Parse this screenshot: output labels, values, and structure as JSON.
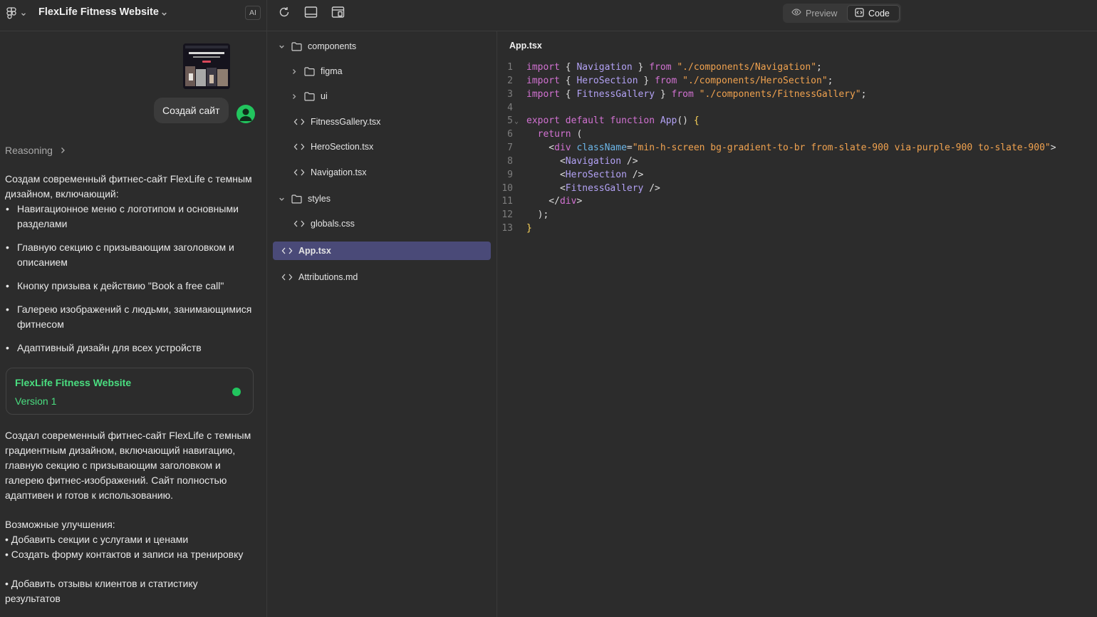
{
  "header": {
    "project_title": "FlexLife Fitness Website",
    "ai_badge": "AI",
    "tabs": {
      "preview": "Preview",
      "code": "Code"
    },
    "active_tab": "Code"
  },
  "chat": {
    "user_message": "Создай сайт",
    "reasoning_label": "Reasoning",
    "intro": "Создам современный фитнес-сайт FlexLife с темным дизайном, включающий:",
    "bullets": [
      "Навигационное меню с логотипом и основными разделами",
      "Главную секцию с призывающим заголовком и описанием",
      "Кнопку призыва к действию \"Book a free call\"",
      "Галерею изображений с людьми, занимающимися фитнесом",
      "Адаптивный дизайн для всех устройств"
    ],
    "version_card": {
      "title": "FlexLife Fitness Website",
      "version": "Version 1"
    },
    "summary": "Создал современный фитнес-сайт FlexLife с темным градиентным дизайном, включающий навигацию, главную секцию с призывающим заголовком и галерею фитнес-изображений. Сайт полностью адаптивен и готов к использованию.",
    "improvements_title": "Возможные улучшения:",
    "improvements": [
      "• Добавить секции с услугами и ценами",
      "• Создать форму контактов и записи на тренировку",
      "• Добавить отзывы клиентов и статистику результатов"
    ]
  },
  "file_tree": {
    "components": "components",
    "figma": "figma",
    "ui": "ui",
    "fitness_gallery": "FitnessGallery.tsx",
    "hero_section": "HeroSection.tsx",
    "navigation": "Navigation.tsx",
    "styles": "styles",
    "globals": "globals.css",
    "app": "App.tsx",
    "attributions": "Attributions.md"
  },
  "editor": {
    "file_name": "App.tsx",
    "line_numbers": [
      "1",
      "2",
      "3",
      "4",
      "5",
      "6",
      "7",
      "8",
      "9",
      "10",
      "11",
      "12",
      "13"
    ],
    "t": {
      "import": "import",
      "from": "from",
      "export": "export",
      "default": "default",
      "function": "function",
      "return": "return",
      "navigation": "Navigation",
      "hero_section": "HeroSection",
      "fitness_gallery": "FitnessGallery",
      "app": "App",
      "div": "div",
      "class_name": "className",
      "path_navigation": "\"./components/Navigation\"",
      "path_hero": "\"./components/HeroSection\"",
      "path_gallery": "\"./components/FitnessGallery\"",
      "class_value": "\"min-h-screen bg-gradient-to-br from-slate-900 via-purple-900 to-slate-900\""
    }
  },
  "colors": {
    "accent_green": "#22c55e",
    "selection": "#4a4a78",
    "background": "#2c2c2c"
  }
}
